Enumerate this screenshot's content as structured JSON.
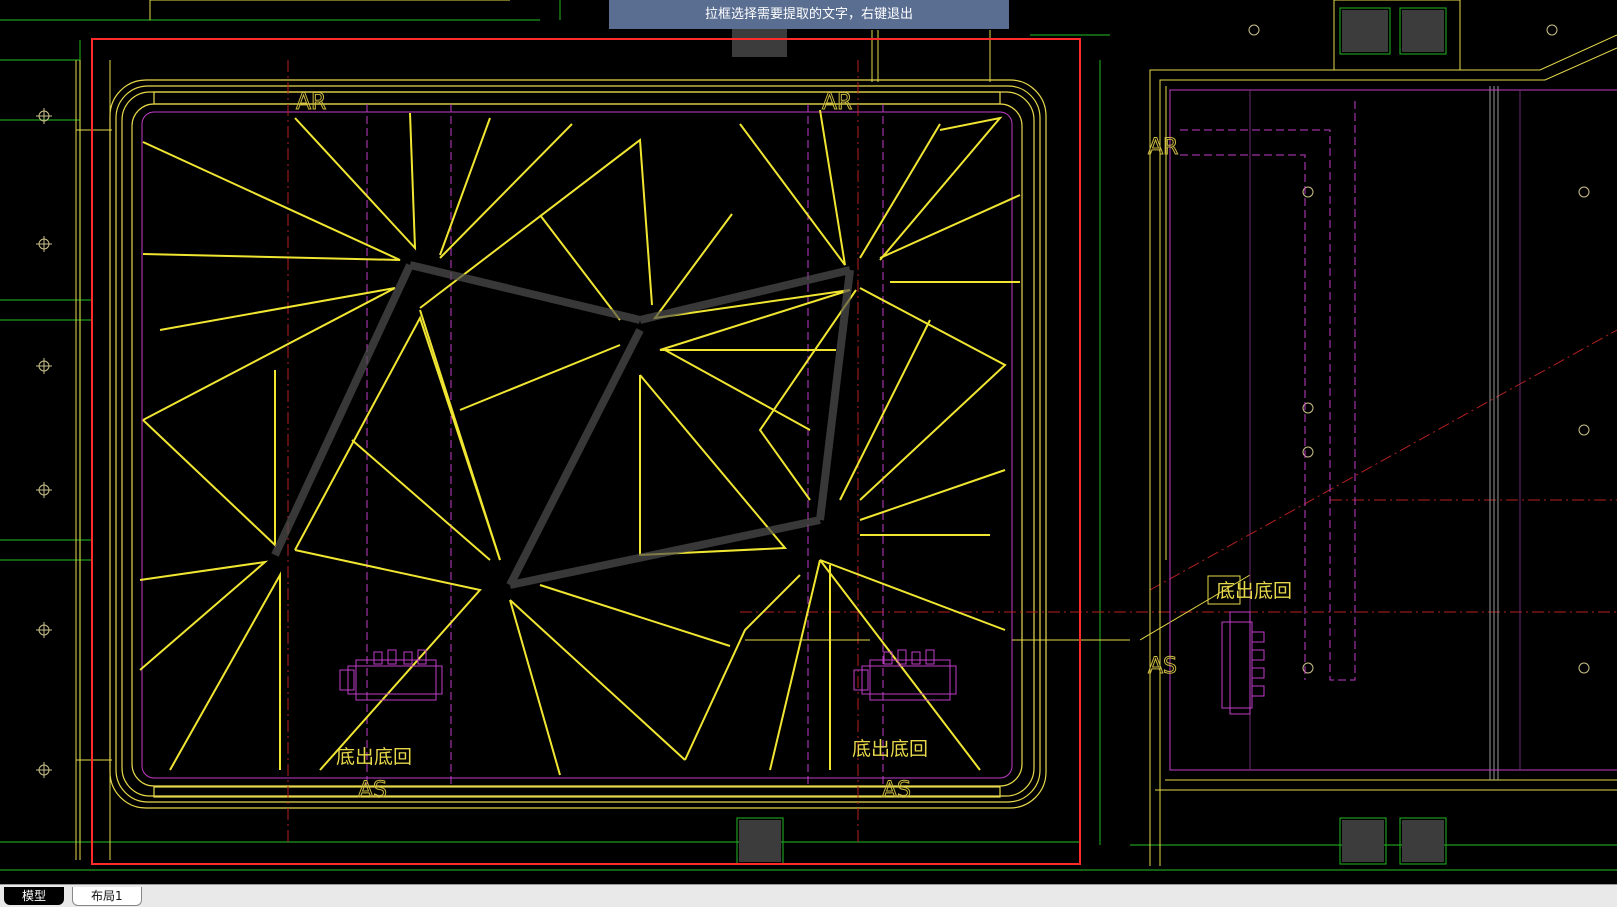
{
  "instruction_banner": "拉框选择需要提取的文字，右键退出",
  "tabs": [
    {
      "label": "模型",
      "active": true
    },
    {
      "label": "布局1",
      "active": false
    }
  ],
  "drawing_labels": {
    "ar_top_left": "AR",
    "ar_top_right": "AR",
    "ar_right_room": "AR",
    "as_bottom_left": "AS",
    "as_bottom_right": "AS",
    "as_right_room": "AS",
    "outlet_left": "底出底回",
    "outlet_right": "底出底回",
    "outlet_right_room": "底出底回"
  },
  "colors": {
    "background": "#000000",
    "selection": "#ff2a2a",
    "wall": "#e6d84a",
    "fixture": "#c03dc8",
    "grid": "#1e9a1e"
  }
}
